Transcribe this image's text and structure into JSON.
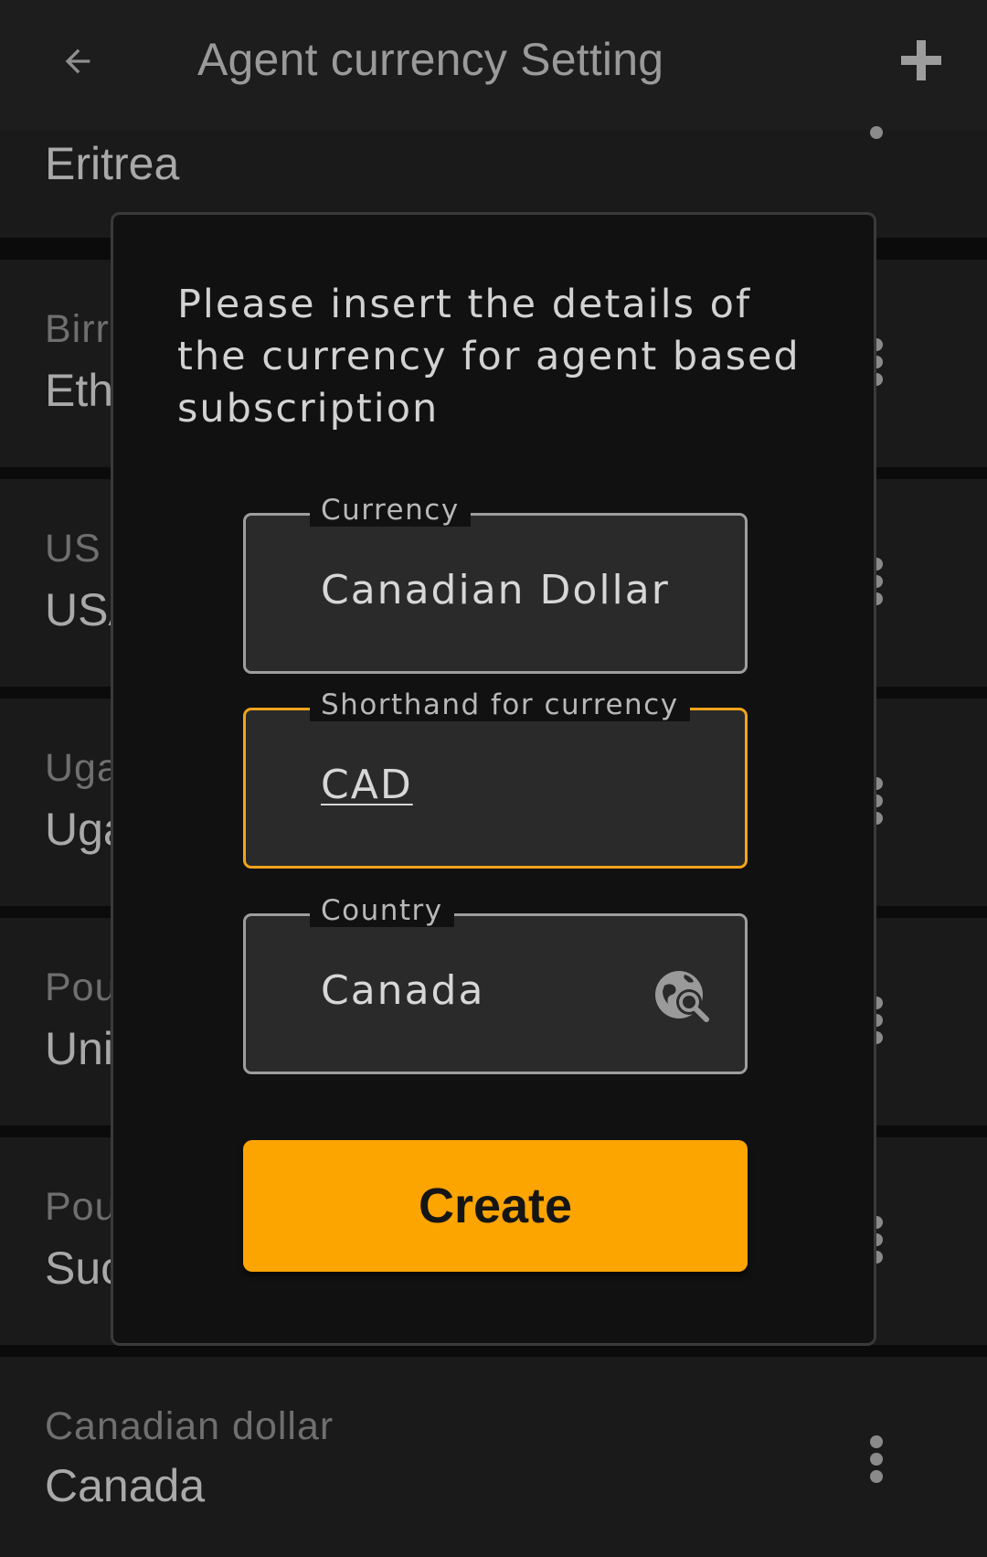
{
  "appbar": {
    "title": "Agent currency Setting",
    "back_icon": "arrow-left-icon",
    "add_icon": "plus-icon"
  },
  "list": {
    "rows": [
      {
        "label": "",
        "value": "Eritrea"
      },
      {
        "label": "Birr",
        "value": "Eth"
      },
      {
        "label": "US",
        "value": "USA"
      },
      {
        "label": "Uga",
        "value": "Uga"
      },
      {
        "label": "Pou",
        "value": "Uni"
      },
      {
        "label": "Pou",
        "value": "Suc"
      },
      {
        "label": "Canadian dollar",
        "value": "Canada"
      }
    ]
  },
  "dialog": {
    "message": "Please insert the details of the currency for agent based subscription",
    "currency": {
      "label": "Currency",
      "value": "Canadian Dollar"
    },
    "shorthand": {
      "label": "Shorthand for currency",
      "value": "CAD"
    },
    "country": {
      "label": "Country",
      "value": "Canada",
      "icon": "globe-search-icon"
    },
    "create_label": "Create"
  },
  "colors": {
    "accent": "#fca400",
    "focus_border": "#f3a31c",
    "background": "#0b0b0b",
    "surface": "#1a1a1a",
    "dialog": "#111111"
  }
}
